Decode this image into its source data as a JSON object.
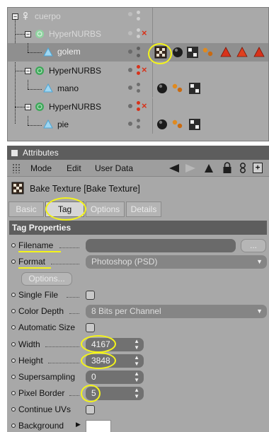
{
  "object_manager": {
    "objects": [
      {
        "name": "cuerpo",
        "dim": true
      },
      {
        "name": "HyperNURBS",
        "dim": true
      },
      {
        "name": "golem",
        "dim": false
      },
      {
        "name": "HyperNURBS",
        "dim": false
      },
      {
        "name": "mano",
        "dim": false
      },
      {
        "name": "HyperNURBS",
        "dim": false
      },
      {
        "name": "pie",
        "dim": false
      }
    ]
  },
  "attributes": {
    "title": "Attributes",
    "menu": {
      "mode": "Mode",
      "edit": "Edit",
      "user_data": "User Data"
    },
    "tag_name": "Bake Texture [Bake Texture]",
    "tabs": [
      {
        "label": "Basic",
        "active": false
      },
      {
        "label": "Tag",
        "active": true
      },
      {
        "label": "Options",
        "active": false
      },
      {
        "label": "Details",
        "active": false
      }
    ],
    "section_title": "Tag Properties",
    "properties": {
      "filename": {
        "label": "Filename",
        "value": "",
        "browse": "..."
      },
      "format": {
        "label": "Format",
        "value": "Photoshop (PSD)"
      },
      "options_button": "Options...",
      "single_file": {
        "label": "Single File"
      },
      "color_depth": {
        "label": "Color Depth",
        "value": "8 Bits per Channel"
      },
      "automatic_size": {
        "label": "Automatic Size"
      },
      "width": {
        "label": "Width",
        "value": "4167"
      },
      "height": {
        "label": "Height",
        "value": "3848"
      },
      "supersampling": {
        "label": "Supersampling",
        "value": "0"
      },
      "pixel_border": {
        "label": "Pixel Border",
        "value": "5"
      },
      "continue_uvs": {
        "label": "Continue UVs"
      },
      "background": {
        "label": "Background",
        "color": "#ffffff"
      }
    }
  },
  "colors": {
    "highlight": "#f4f41a",
    "panel_bg": "#a8a8a8",
    "header_bg": "#5d5d5d",
    "hypernurbs_icon": "#3fa85a",
    "polygon_icon": "#5fb6e6",
    "tag_red": "#d8321a"
  }
}
